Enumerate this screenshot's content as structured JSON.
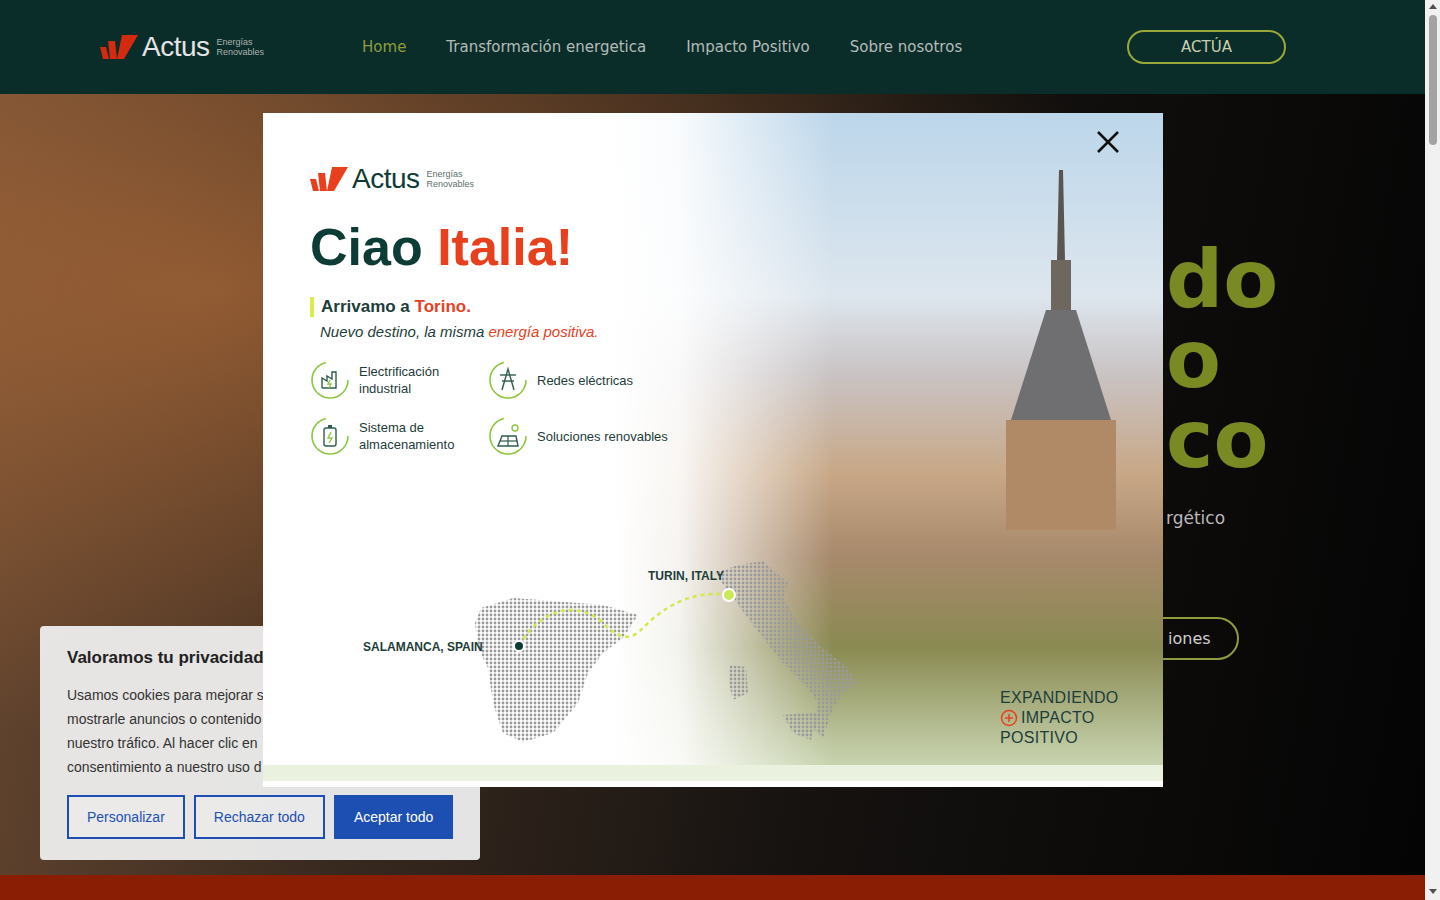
{
  "header": {
    "logo": {
      "name": "Actus",
      "tagline": [
        "Energías",
        "Renovables"
      ]
    },
    "nav": [
      {
        "label": "Home",
        "selected": true
      },
      {
        "label": "Transformación energetica",
        "selected": false
      },
      {
        "label": "Impacto Positivo",
        "selected": false
      },
      {
        "label": "Sobre nosotros",
        "selected": false
      }
    ],
    "cta": "ACTÚA"
  },
  "hero": {
    "title_lines": [
      "do",
      "o",
      "co"
    ],
    "subtitle": "rgético",
    "button": "iones"
  },
  "modal": {
    "logo": {
      "name": "Actus",
      "tagline": [
        "Energías",
        "Renovables"
      ]
    },
    "title": {
      "lead": "Ciao",
      "accent": "Italia!"
    },
    "headline": {
      "lead": "Arrivamo a",
      "accent": "Torino."
    },
    "tagline": {
      "lead": "Nuevo destino, la misma",
      "accent": "energía positiva."
    },
    "features": [
      {
        "label": "Electrificación industrial",
        "kind": "factory"
      },
      {
        "label": "Redes eléctricas",
        "kind": "tower"
      },
      {
        "label": "Sistema de almacenamiento",
        "kind": "battery"
      },
      {
        "label": "Soluciones renovables",
        "kind": "solar"
      }
    ],
    "map": {
      "origin": "SALAMANCA, SPAIN",
      "destination": "TURIN, ITALY"
    },
    "slogan": [
      "EXPANDIENDO",
      "IMPACTO",
      "POSITIVO"
    ]
  },
  "cookie": {
    "title": "Valoramos tu privacidad",
    "lines": [
      "Usamos cookies para mejorar s",
      "mostrarle anuncios o contenido",
      "nuestro tráfico. Al hacer clic en",
      "consentimiento a nuestro uso d"
    ],
    "buttons": [
      {
        "label": "Personalizar",
        "kind": "outline"
      },
      {
        "label": "Rechazar todo",
        "kind": "outline"
      },
      {
        "label": "Aceptar todo",
        "kind": "filled"
      }
    ]
  }
}
